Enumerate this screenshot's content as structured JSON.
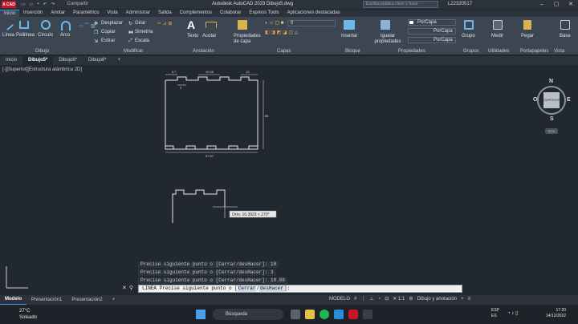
{
  "app": {
    "title": "Autodesk AutoCAD 2023   Dibujo5.dwg",
    "logo": "A CAD",
    "share": "Compartir",
    "search_placeholder": "Escriba palabra clave o frase",
    "user": "L22320517"
  },
  "ribbon_tabs": [
    "Inicio",
    "Inserción",
    "Anotar",
    "Paramétrico",
    "Vista",
    "Administrar",
    "Salida",
    "Complementos",
    "Colaborar",
    "Express Tools",
    "Aplicaciones destacadas"
  ],
  "ribbon": {
    "dibujo": {
      "title": "Dibujo",
      "linea": "Línea",
      "polilinea": "Polilínea",
      "circulo": "Círculo",
      "arco": "Arco"
    },
    "modificar": {
      "title": "Modificar",
      "desplazar": "Desplazar",
      "girar": "Girar",
      "copiar": "Copiar",
      "simetria": "Simetría",
      "estirar": "Estirar",
      "escala": "Escala"
    },
    "anotacion": {
      "title": "Anotación",
      "texto": "Texto",
      "acotar": "Acotar"
    },
    "capas": {
      "title": "Capas",
      "propiedades_capa": "Propiedades de capa",
      "layer_value": "0"
    },
    "bloque": {
      "title": "Bloque",
      "insertar": "Insertar"
    },
    "propiedades": {
      "title": "Propiedades",
      "igualar": "Igualar propiedades",
      "porcapa1": "PorCapa",
      "porcapa2": "PorCapa",
      "porcapa3": "PorCapa"
    },
    "grupos": {
      "title": "Grupos",
      "grupo": "Grupo"
    },
    "utilidades": {
      "title": "Utilidades",
      "medir": "Medir"
    },
    "portapapeles": {
      "title": "Portapapeles",
      "pegar": "Pegar"
    },
    "vista": {
      "title": "Vista",
      "base": "Base"
    }
  },
  "file_tabs": [
    "Inicio",
    "Dibujo5*",
    "Dibujo6*",
    "Dibujo8*"
  ],
  "viewport_label": "[-][Superior][Estructura alámbrica 2D]",
  "viewcube": {
    "n": "N",
    "s": "S",
    "e": "E",
    "o": "O",
    "face": "SUPERIOR",
    "scu": "SCU"
  },
  "drawing": {
    "dim_top_left": "3.7",
    "dim_top_mid": "10.06",
    "dim_top_right": "13",
    "dim_small": "3",
    "dim_side": "85",
    "dim_bottom": "97.57",
    "tooltip": "Orto: 10.3923 < 270°"
  },
  "command_history": [
    "Precise siguiente punto o [Cerrar/desHacer]: 10",
    "Precise siguiente punto o [Cerrar/desHacer]: 3",
    "Precise siguiente punto o [Cerrar/desHacer]: 10.06"
  ],
  "command_line": {
    "prefix": "LINEA Precise siguiente punto o [",
    "opt1": "Cerrar",
    "opt2": "desHacer",
    "suffix": "]:"
  },
  "layout_tabs": [
    "Modelo",
    "Presentación1",
    "Presentación2"
  ],
  "status": {
    "model": "MODELO",
    "workspace": "Dibujo y anotación"
  },
  "taskbar": {
    "temp": "27°C",
    "weather": "Soleado",
    "search": "Búsqueda",
    "lang1": "ESP",
    "lang2": "ES",
    "time": "17:20",
    "date": "14/12/2022"
  }
}
